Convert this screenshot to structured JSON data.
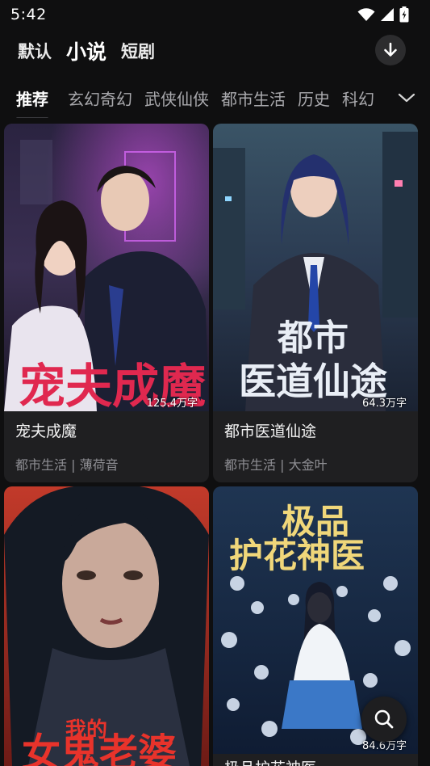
{
  "status_bar": {
    "time": "5:42"
  },
  "mode_tabs": [
    {
      "label": "默认"
    },
    {
      "label": "小说"
    },
    {
      "label": "短剧"
    }
  ],
  "categories": [
    {
      "label": "推荐"
    },
    {
      "label": "玄幻奇幻"
    },
    {
      "label": "武侠仙侠"
    },
    {
      "label": "都市生活"
    },
    {
      "label": "历史"
    },
    {
      "label": "科幻"
    }
  ],
  "books": [
    {
      "title": "宠夫成魔",
      "meta": "都市生活 | 薄荷音",
      "word_count": "125.4万字",
      "cover_text": "宠夫成魔"
    },
    {
      "title": "都市医道仙途",
      "meta": "都市生活 | 大金叶",
      "word_count": "64.3万字",
      "cover_text_1": "都市",
      "cover_text_2": "医道仙途"
    },
    {
      "title": "",
      "meta": "",
      "word_count": "",
      "cover_text_1": "我的",
      "cover_text_2": "女鬼老婆"
    },
    {
      "title": "极品护花神医",
      "meta": "",
      "word_count": "84.6万字",
      "cover_text_1": "极品",
      "cover_text_2": "护花神医"
    }
  ],
  "colors": {
    "background": "#0f0f10",
    "card": "#1f1f21",
    "muted_text": "#8e8e93",
    "cover_red_title": "#e0284f"
  },
  "icons": [
    "wifi-icon",
    "signal-icon",
    "battery-icon",
    "download-icon",
    "chevron-down-icon",
    "search-icon"
  ]
}
